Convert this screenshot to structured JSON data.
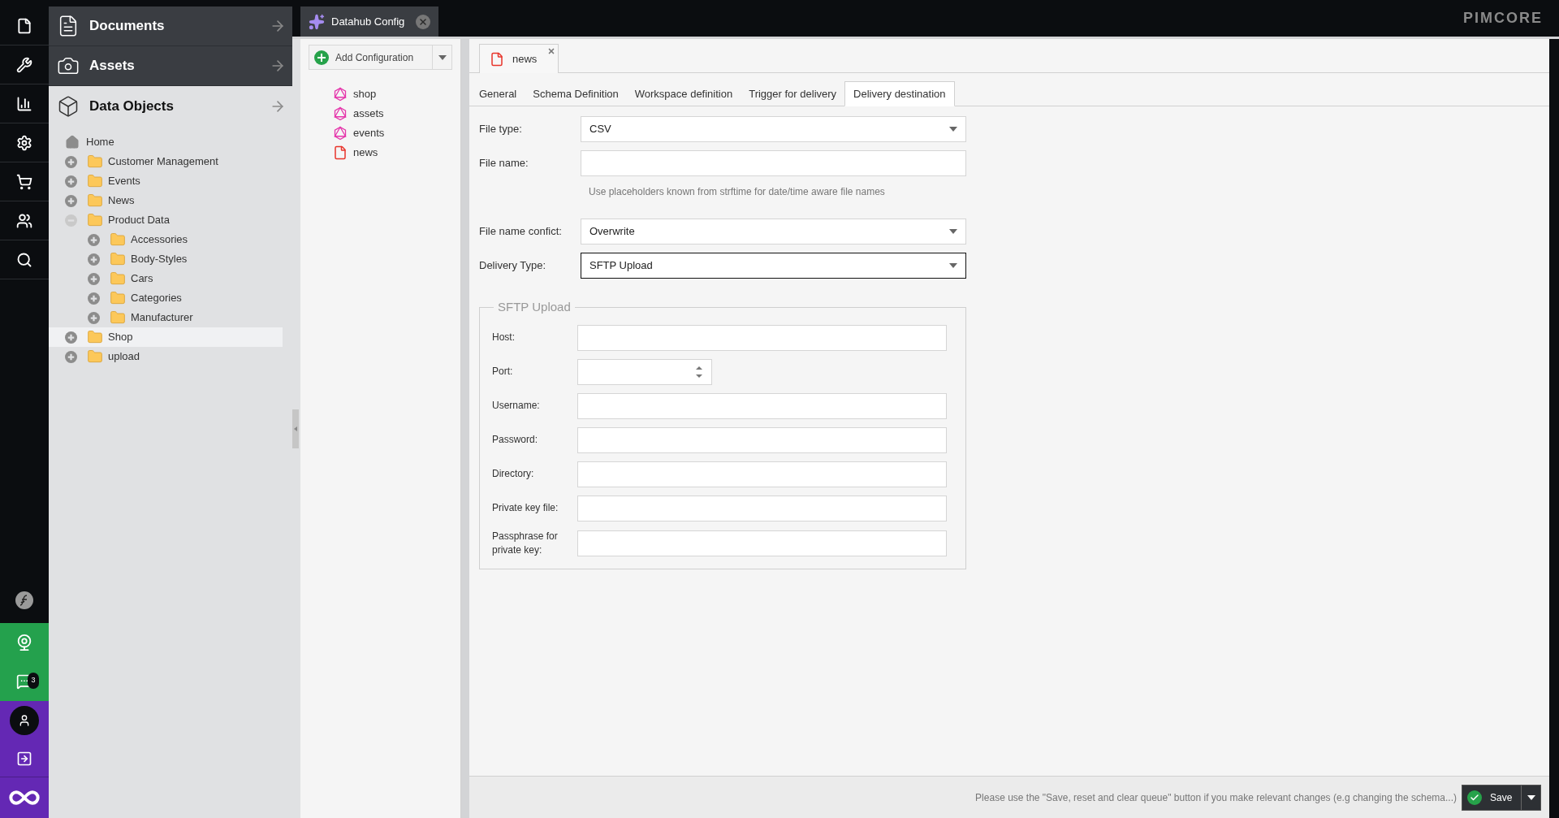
{
  "logo": "PIMCORE",
  "rail": {
    "badge": "3"
  },
  "nav_panels": [
    {
      "label": "Documents",
      "kind": "documents",
      "selected": false
    },
    {
      "label": "Assets",
      "kind": "assets",
      "selected": false
    },
    {
      "label": "Data Objects",
      "kind": "objects",
      "selected": true
    }
  ],
  "tree": [
    {
      "label": "Home",
      "kind": "root"
    },
    {
      "label": "Customer Management",
      "kind": "folder",
      "expanded": false,
      "selected": false
    },
    {
      "label": "Events",
      "kind": "folder",
      "expanded": false,
      "selected": false
    },
    {
      "label": "News",
      "kind": "folder",
      "expanded": false,
      "selected": false
    },
    {
      "label": "Product Data",
      "kind": "folder",
      "expanded": true,
      "selected": false,
      "children": [
        {
          "label": "Accessories",
          "kind": "folder",
          "expanded": false,
          "selected": false
        },
        {
          "label": "Body-Styles",
          "kind": "folder",
          "expanded": false,
          "selected": false
        },
        {
          "label": "Cars",
          "kind": "folder",
          "expanded": false,
          "selected": false
        },
        {
          "label": "Categories",
          "kind": "folder",
          "expanded": false,
          "selected": false
        },
        {
          "label": "Manufacturer",
          "kind": "folder",
          "expanded": false,
          "selected": false
        }
      ]
    },
    {
      "label": "Shop",
      "kind": "folder",
      "expanded": false,
      "selected": true
    },
    {
      "label": "upload",
      "kind": "folder",
      "expanded": false,
      "selected": false
    }
  ],
  "main_tab": {
    "label": "Datahub Config"
  },
  "add_button": {
    "label": "Add Configuration"
  },
  "configs": [
    {
      "label": "shop",
      "kind": "graphql"
    },
    {
      "label": "assets",
      "kind": "graphql"
    },
    {
      "label": "events",
      "kind": "graphql"
    },
    {
      "label": "news",
      "kind": "file"
    }
  ],
  "doc_tab": {
    "label": "news"
  },
  "tabs": [
    {
      "label": "General",
      "selected": false
    },
    {
      "label": "Schema Definition",
      "selected": false
    },
    {
      "label": "Workspace definition",
      "selected": false
    },
    {
      "label": "Trigger for delivery",
      "selected": false
    },
    {
      "label": "Delivery destination",
      "selected": true
    }
  ],
  "form": [
    {
      "label": "File type:",
      "kind": "select",
      "value": "CSV",
      "focused": false
    },
    {
      "label": "File name:",
      "kind": "text",
      "hint": "Use placeholders known from strftime for date/time aware file names"
    },
    {
      "label": "File name confict:",
      "kind": "select",
      "value": "Overwrite",
      "focused": false
    },
    {
      "label": "Delivery Type:",
      "kind": "select",
      "value": "SFTP Upload",
      "focused": true
    }
  ],
  "fieldset": {
    "legend": "SFTP Upload",
    "fields": [
      {
        "label": "Host:",
        "kind": "text"
      },
      {
        "label": "Port:",
        "kind": "number"
      },
      {
        "label": "Username:",
        "kind": "text"
      },
      {
        "label": "Password:",
        "kind": "text"
      },
      {
        "label": "Directory:",
        "kind": "text"
      },
      {
        "label": "Private key file:",
        "kind": "text"
      },
      {
        "label": "Passphrase for private key:",
        "kind": "text"
      }
    ]
  },
  "footer": {
    "note": "Please use the \"Save, reset and clear queue\" button if you make relevant changes (e.g changing the schema...)",
    "save": "Save"
  }
}
